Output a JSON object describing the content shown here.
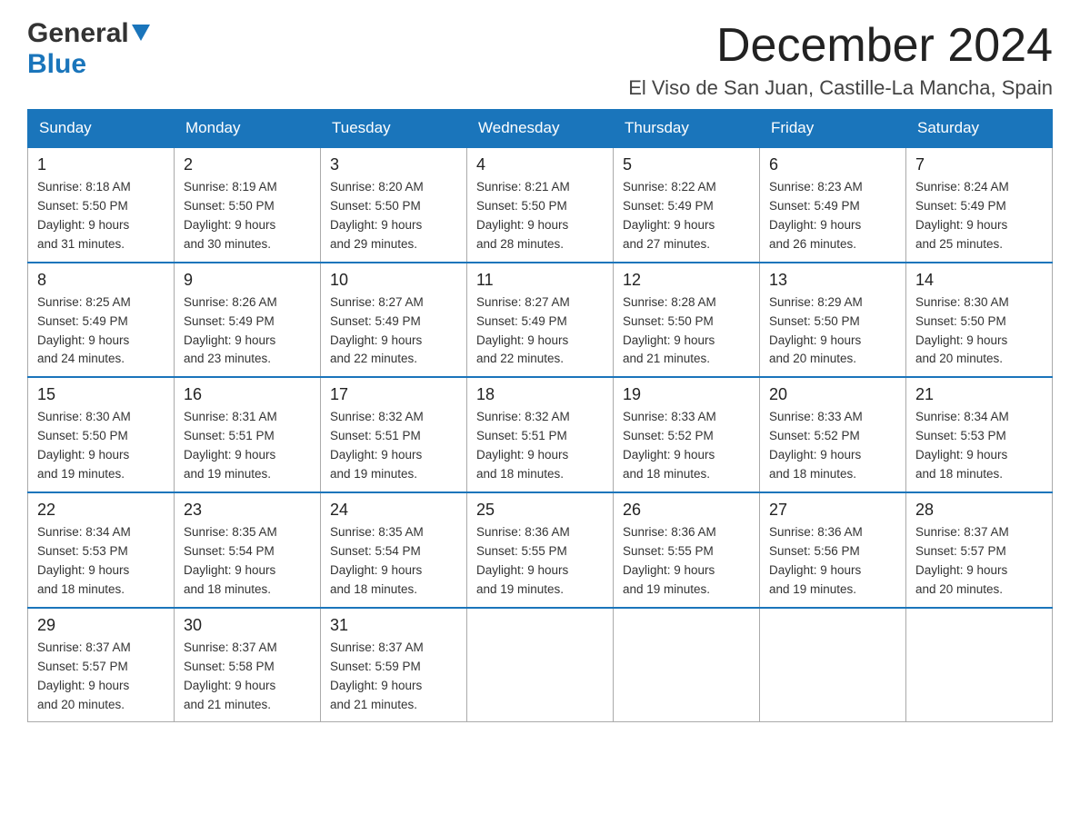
{
  "header": {
    "logo_general": "General",
    "logo_blue": "Blue",
    "month_title": "December 2024",
    "location": "El Viso de San Juan, Castille-La Mancha, Spain"
  },
  "days_of_week": [
    "Sunday",
    "Monday",
    "Tuesday",
    "Wednesday",
    "Thursday",
    "Friday",
    "Saturday"
  ],
  "weeks": [
    [
      {
        "day": "1",
        "sunrise": "8:18 AM",
        "sunset": "5:50 PM",
        "daylight": "9 hours and 31 minutes."
      },
      {
        "day": "2",
        "sunrise": "8:19 AM",
        "sunset": "5:50 PM",
        "daylight": "9 hours and 30 minutes."
      },
      {
        "day": "3",
        "sunrise": "8:20 AM",
        "sunset": "5:50 PM",
        "daylight": "9 hours and 29 minutes."
      },
      {
        "day": "4",
        "sunrise": "8:21 AM",
        "sunset": "5:50 PM",
        "daylight": "9 hours and 28 minutes."
      },
      {
        "day": "5",
        "sunrise": "8:22 AM",
        "sunset": "5:49 PM",
        "daylight": "9 hours and 27 minutes."
      },
      {
        "day": "6",
        "sunrise": "8:23 AM",
        "sunset": "5:49 PM",
        "daylight": "9 hours and 26 minutes."
      },
      {
        "day": "7",
        "sunrise": "8:24 AM",
        "sunset": "5:49 PM",
        "daylight": "9 hours and 25 minutes."
      }
    ],
    [
      {
        "day": "8",
        "sunrise": "8:25 AM",
        "sunset": "5:49 PM",
        "daylight": "9 hours and 24 minutes."
      },
      {
        "day": "9",
        "sunrise": "8:26 AM",
        "sunset": "5:49 PM",
        "daylight": "9 hours and 23 minutes."
      },
      {
        "day": "10",
        "sunrise": "8:27 AM",
        "sunset": "5:49 PM",
        "daylight": "9 hours and 22 minutes."
      },
      {
        "day": "11",
        "sunrise": "8:27 AM",
        "sunset": "5:49 PM",
        "daylight": "9 hours and 22 minutes."
      },
      {
        "day": "12",
        "sunrise": "8:28 AM",
        "sunset": "5:50 PM",
        "daylight": "9 hours and 21 minutes."
      },
      {
        "day": "13",
        "sunrise": "8:29 AM",
        "sunset": "5:50 PM",
        "daylight": "9 hours and 20 minutes."
      },
      {
        "day": "14",
        "sunrise": "8:30 AM",
        "sunset": "5:50 PM",
        "daylight": "9 hours and 20 minutes."
      }
    ],
    [
      {
        "day": "15",
        "sunrise": "8:30 AM",
        "sunset": "5:50 PM",
        "daylight": "9 hours and 19 minutes."
      },
      {
        "day": "16",
        "sunrise": "8:31 AM",
        "sunset": "5:51 PM",
        "daylight": "9 hours and 19 minutes."
      },
      {
        "day": "17",
        "sunrise": "8:32 AM",
        "sunset": "5:51 PM",
        "daylight": "9 hours and 19 minutes."
      },
      {
        "day": "18",
        "sunrise": "8:32 AM",
        "sunset": "5:51 PM",
        "daylight": "9 hours and 18 minutes."
      },
      {
        "day": "19",
        "sunrise": "8:33 AM",
        "sunset": "5:52 PM",
        "daylight": "9 hours and 18 minutes."
      },
      {
        "day": "20",
        "sunrise": "8:33 AM",
        "sunset": "5:52 PM",
        "daylight": "9 hours and 18 minutes."
      },
      {
        "day": "21",
        "sunrise": "8:34 AM",
        "sunset": "5:53 PM",
        "daylight": "9 hours and 18 minutes."
      }
    ],
    [
      {
        "day": "22",
        "sunrise": "8:34 AM",
        "sunset": "5:53 PM",
        "daylight": "9 hours and 18 minutes."
      },
      {
        "day": "23",
        "sunrise": "8:35 AM",
        "sunset": "5:54 PM",
        "daylight": "9 hours and 18 minutes."
      },
      {
        "day": "24",
        "sunrise": "8:35 AM",
        "sunset": "5:54 PM",
        "daylight": "9 hours and 18 minutes."
      },
      {
        "day": "25",
        "sunrise": "8:36 AM",
        "sunset": "5:55 PM",
        "daylight": "9 hours and 19 minutes."
      },
      {
        "day": "26",
        "sunrise": "8:36 AM",
        "sunset": "5:55 PM",
        "daylight": "9 hours and 19 minutes."
      },
      {
        "day": "27",
        "sunrise": "8:36 AM",
        "sunset": "5:56 PM",
        "daylight": "9 hours and 19 minutes."
      },
      {
        "day": "28",
        "sunrise": "8:37 AM",
        "sunset": "5:57 PM",
        "daylight": "9 hours and 20 minutes."
      }
    ],
    [
      {
        "day": "29",
        "sunrise": "8:37 AM",
        "sunset": "5:57 PM",
        "daylight": "9 hours and 20 minutes."
      },
      {
        "day": "30",
        "sunrise": "8:37 AM",
        "sunset": "5:58 PM",
        "daylight": "9 hours and 21 minutes."
      },
      {
        "day": "31",
        "sunrise": "8:37 AM",
        "sunset": "5:59 PM",
        "daylight": "9 hours and 21 minutes."
      },
      null,
      null,
      null,
      null
    ]
  ],
  "labels": {
    "sunrise_prefix": "Sunrise: ",
    "sunset_prefix": "Sunset: ",
    "daylight_prefix": "Daylight: "
  }
}
